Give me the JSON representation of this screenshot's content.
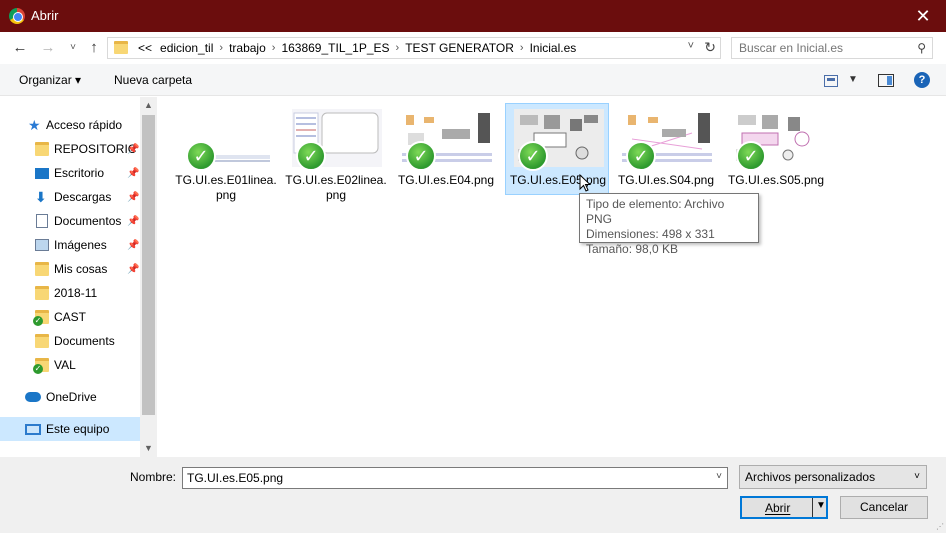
{
  "window": {
    "title": "Abrir",
    "close_glyph": "✕"
  },
  "address": {
    "crumbs": [
      "<<",
      "edicion_til",
      "trabajo",
      "163869_TIL_1P_ES",
      "TEST GENERATOR",
      "Inicial.es"
    ],
    "search_placeholder": "Buscar en Inicial.es"
  },
  "toolbar": {
    "organize_label": "Organizar ▾",
    "new_folder_label": "Nueva carpeta",
    "help_label": "?"
  },
  "sidebar": {
    "items": [
      {
        "label": "Acceso rápido",
        "icon": "star-icon",
        "pinned": false
      },
      {
        "label": "REPOSITORIC",
        "icon": "folder-icon",
        "pinned": true
      },
      {
        "label": "Escritorio",
        "icon": "desktop-icon",
        "pinned": true
      },
      {
        "label": "Descargas",
        "icon": "download-icon",
        "pinned": true
      },
      {
        "label": "Documentos",
        "icon": "documents-icon",
        "pinned": true
      },
      {
        "label": "Imágenes",
        "icon": "pictures-icon",
        "pinned": true
      },
      {
        "label": "Mis cosas",
        "icon": "folder-icon",
        "pinned": true
      },
      {
        "label": "2018-11",
        "icon": "folder-icon",
        "pinned": false
      },
      {
        "label": "CAST",
        "icon": "folder-synced-icon",
        "pinned": false
      },
      {
        "label": "Documents",
        "icon": "folder-icon",
        "pinned": false
      },
      {
        "label": "VAL",
        "icon": "folder-synced-icon",
        "pinned": false
      },
      {
        "label": "OneDrive",
        "icon": "onedrive-icon",
        "pinned": false
      },
      {
        "label": "Este equipo",
        "icon": "this-pc-icon",
        "pinned": false,
        "selected": true
      }
    ]
  },
  "files": [
    {
      "name": "TG.UI.es.E01linea.\npng",
      "line1": "TG.UI.es.E01linea.",
      "line2": "png"
    },
    {
      "name": "TG.UI.es.E02linea.png",
      "line1": "TG.UI.es.E02linea.",
      "line2": "png"
    },
    {
      "name": "TG.UI.es.E04.png",
      "line1": "TG.UI.es.E04.png",
      "line2": ""
    },
    {
      "name": "TG.UI.es.E05.png",
      "line1": "TG.UI.es.E05.png",
      "line2": "",
      "selected": true
    },
    {
      "name": "TG.UI.es.S04.png",
      "line1": "TG.UI.es.S04.png",
      "line2": ""
    },
    {
      "name": "TG.UI.es.S05.png",
      "line1": "TG.UI.es.S05.png",
      "line2": ""
    }
  ],
  "tooltip": {
    "type": "Tipo de elemento: Archivo PNG",
    "dimensions": "Dimensiones: 498 x 331",
    "size": "Tamaño: 98,0 KB"
  },
  "footer": {
    "name_label": "Nombre:",
    "name_value": "TG.UI.es.E05.png",
    "filter_value": "Archivos personalizados",
    "open_label": "Abrir",
    "cancel_label": "Cancelar"
  },
  "colors": {
    "titlebar": "#6b0d0d",
    "selection": "#cce8ff",
    "accent": "#0078d7",
    "synced_check": "#2e9a2e"
  }
}
